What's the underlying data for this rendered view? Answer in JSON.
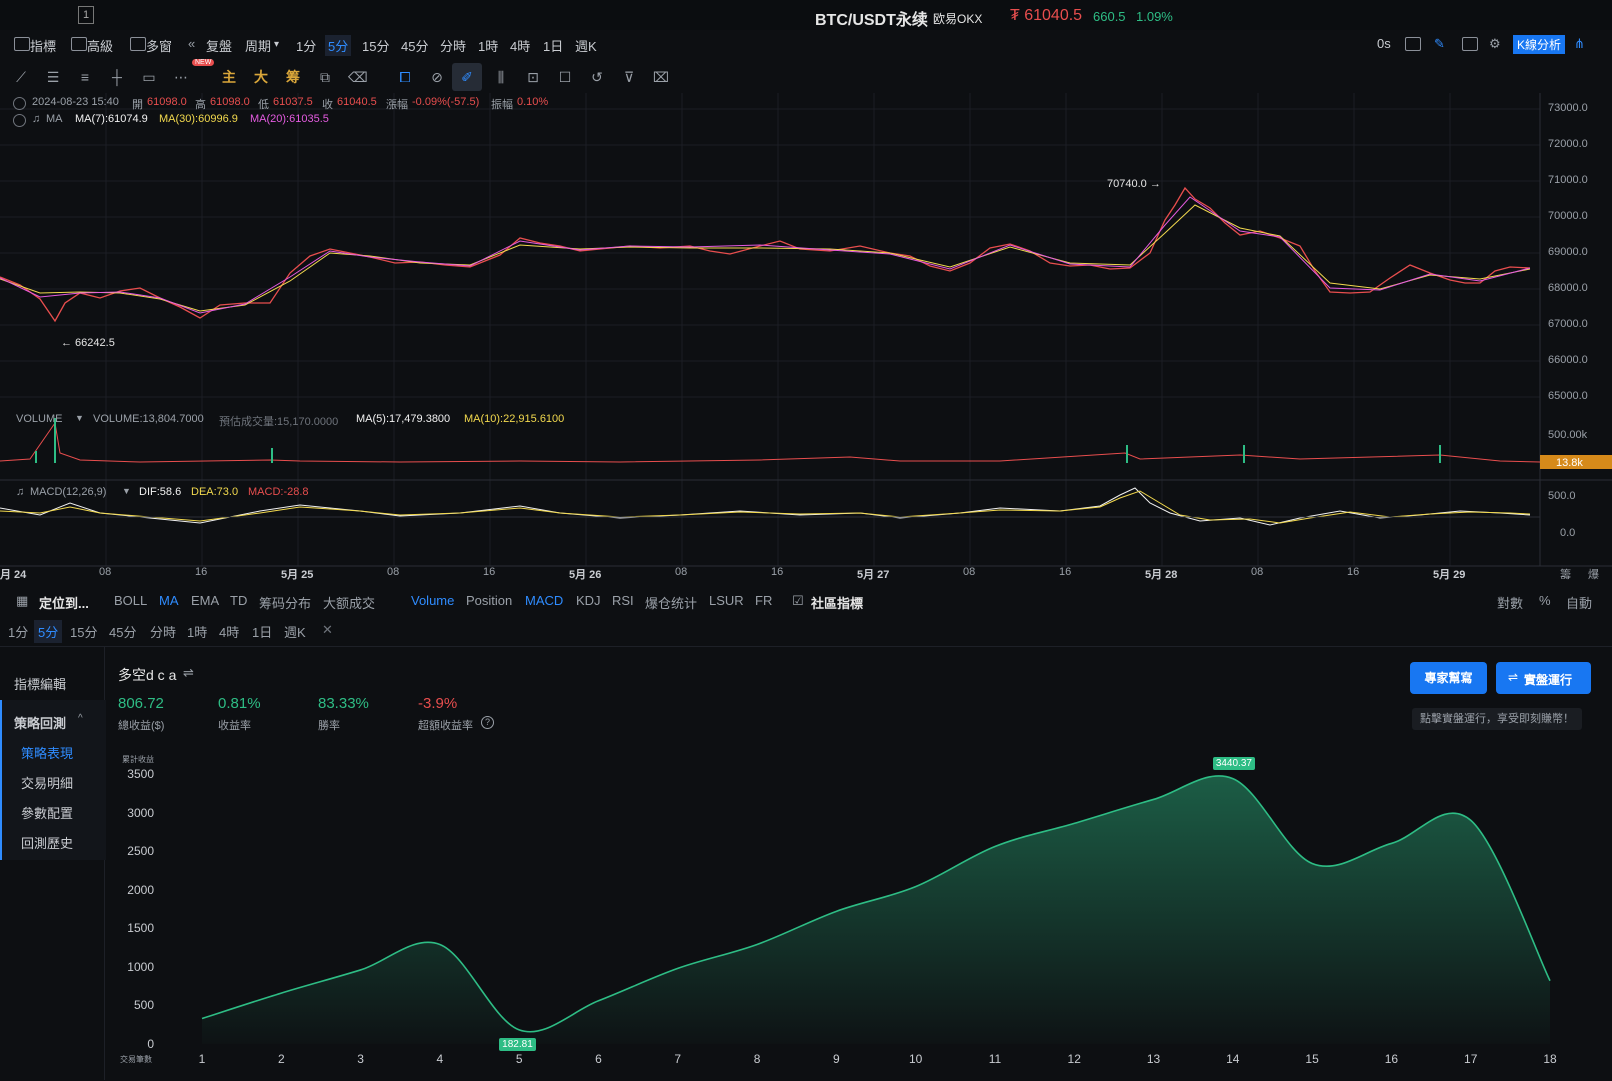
{
  "window_number": "1",
  "header": {
    "title": "BTC/USDT永续",
    "exchange": "欧易OKX",
    "price": "₮ 61040.5",
    "change": "660.5",
    "change_pct": "1.09%"
  },
  "toolbar": {
    "indicators": "指標",
    "advanced": "高級",
    "multi_window": "多窗",
    "replay": "复盤",
    "period": "周期",
    "timeframes": [
      "1分",
      "5分",
      "15分",
      "45分",
      "分時",
      "1時",
      "4時",
      "1日",
      "週K"
    ],
    "active_timeframe": "5分",
    "countdown": "0s",
    "kline_analysis": "K線分析"
  },
  "drawing_tools": {
    "new_badge": "NEW",
    "cn_tools": [
      "主",
      "大",
      "筹"
    ],
    "icons": [
      "trend-line-icon",
      "parallel-lines-icon",
      "horizontal-lines-icon",
      "cross-line-icon",
      "rectangle-icon",
      "more-icon",
      "clone-icon",
      "eraser-icon",
      "overlay-icon",
      "select-icon",
      "ruler-icon",
      "pencil-icon",
      "candles-icon",
      "lock-icon",
      "note-icon",
      "magnet-icon",
      "filter-icon",
      "trash-icon"
    ]
  },
  "ohlc_line": {
    "datetime": "2024-08-23 15:40",
    "open_label": "開",
    "open": "61098.0",
    "high_label": "高",
    "high": "61098.0",
    "low_label": "低",
    "low": "61037.5",
    "close_label": "收",
    "close": "61040.5",
    "change_label": "漲幅",
    "change": "-0.09%(-57.5)",
    "amp_label": "振幅",
    "amp": "0.10%"
  },
  "ma_line": {
    "label": "MA",
    "ma7": "MA(7):61074.9",
    "ma30": "MA(30):60996.9",
    "ma20": "MA(20):61035.5"
  },
  "price_chart": {
    "high_marker": "70740.0 →",
    "low_marker": "← 66242.5",
    "y_axis": [
      "73000.0",
      "72000.0",
      "71000.0",
      "70000.0",
      "69000.0",
      "68000.0",
      "67000.0",
      "66000.0",
      "65000.0"
    ]
  },
  "volume_line": {
    "label": "VOLUME",
    "volume": "VOLUME:13,804.7000",
    "est": "預估成交量:15,170.0000",
    "ma5": "MA(5):17,479.3800",
    "ma10": "MA(10):22,915.6100",
    "y_top": "500.00k",
    "current_tag": "13.8k"
  },
  "macd_line": {
    "label": "MACD(12,26,9)",
    "dif": "DIF:58.6",
    "dea": "DEA:73.0",
    "macd": "MACD:-28.8",
    "y_axis": [
      "500.0",
      "0.0"
    ]
  },
  "x_axis": {
    "labels": [
      "月 24",
      "08",
      "16",
      "5月 25",
      "08",
      "16",
      "5月 26",
      "08",
      "16",
      "5月 27",
      "08",
      "16",
      "5月 28",
      "08",
      "16",
      "5月 29"
    ],
    "right": [
      "籌",
      "爆"
    ]
  },
  "indicator_bar": {
    "locate": "定位到...",
    "items": [
      "BOLL",
      "MA",
      "EMA",
      "TD",
      "筹码分布",
      "大额成交"
    ],
    "sub_items": [
      "Volume",
      "Position",
      "MACD",
      "KDJ",
      "RSI",
      "爆仓统计",
      "LSUR",
      "FR"
    ],
    "community": "社區指標",
    "right": [
      "對數",
      "%",
      "自動"
    ]
  },
  "timeframe_bar": {
    "items": [
      "1分",
      "5分",
      "15分",
      "45分",
      "分時",
      "1時",
      "4時",
      "1日",
      "週K"
    ],
    "active": "5分",
    "close": "✕"
  },
  "sidebar": {
    "indicator_edit": "指標編輯",
    "backtest": "策略回測",
    "items": [
      "策略表現",
      "交易明細",
      "參數配置",
      "回測歷史"
    ],
    "active": "策略表現"
  },
  "strategy": {
    "name": "多空d c a",
    "stats": [
      {
        "value": "806.72",
        "label": "總收益($)",
        "color": "#2ebd85"
      },
      {
        "value": "0.81%",
        "label": "收益率",
        "color": "#2ebd85"
      },
      {
        "value": "83.33%",
        "label": "勝率",
        "color": "#2ebd85"
      },
      {
        "value": "-3.9%",
        "label": "超額收益率",
        "color": "#e84e4e"
      }
    ],
    "expert_button": "專家幫寫",
    "live_button": "實盤運行",
    "hint": "點擊實盤運行，享受即刻賺幣！"
  },
  "chart_data": {
    "type": "area",
    "ylabel": "累計收益",
    "xlabel": "交易筆數",
    "x": [
      1,
      2,
      3,
      4,
      5,
      6,
      7,
      8,
      9,
      10,
      11,
      12,
      13,
      14,
      15,
      16,
      17,
      18
    ],
    "values": [
      330,
      660,
      960,
      1290,
      182.81,
      560,
      980,
      1290,
      1720,
      2040,
      2560,
      2860,
      3170,
      3440.37,
      2340,
      2600,
      2900,
      820
    ],
    "annotations": [
      "3440.37",
      "182.81"
    ],
    "ylim": [
      0,
      3500
    ],
    "yticks": [
      0,
      500,
      1000,
      1500,
      2000,
      2500,
      3000,
      3500
    ],
    "grid": false,
    "colors": {
      "line": "#2ebd85",
      "fill": "#2ebd85"
    }
  }
}
